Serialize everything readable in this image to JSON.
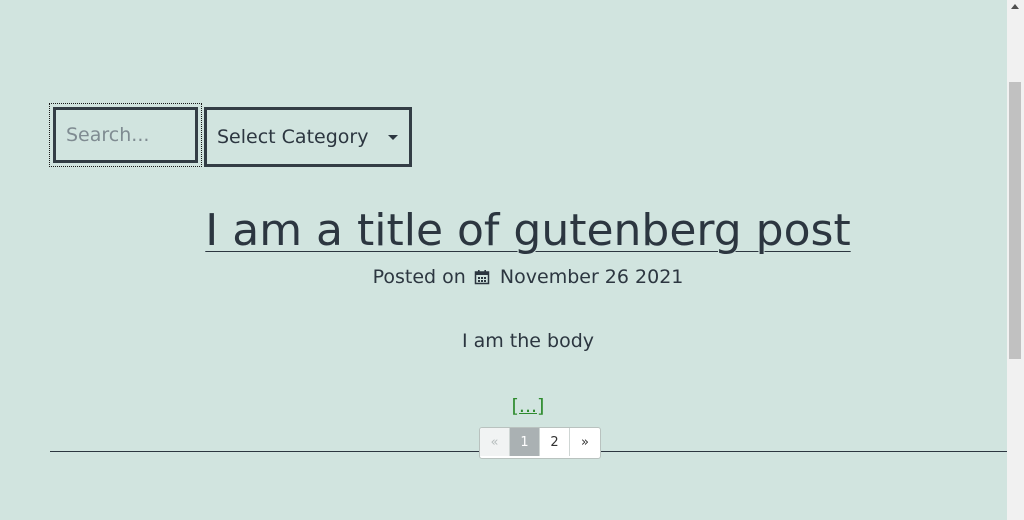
{
  "search": {
    "placeholder": "Search..."
  },
  "category": {
    "selected": "Select Category"
  },
  "post": {
    "title": "I am a title of gutenberg post",
    "posted_prefix": "Posted on",
    "date": "November 26 2021",
    "body": "I am the body",
    "more": "[...]"
  },
  "pagination": {
    "prev": "«",
    "pages": [
      "1",
      "2"
    ],
    "next": "»"
  },
  "icons": {
    "calendar": "calendar-icon",
    "caret": "chevron-down-icon",
    "scroll_up": "arrow-up-icon"
  }
}
